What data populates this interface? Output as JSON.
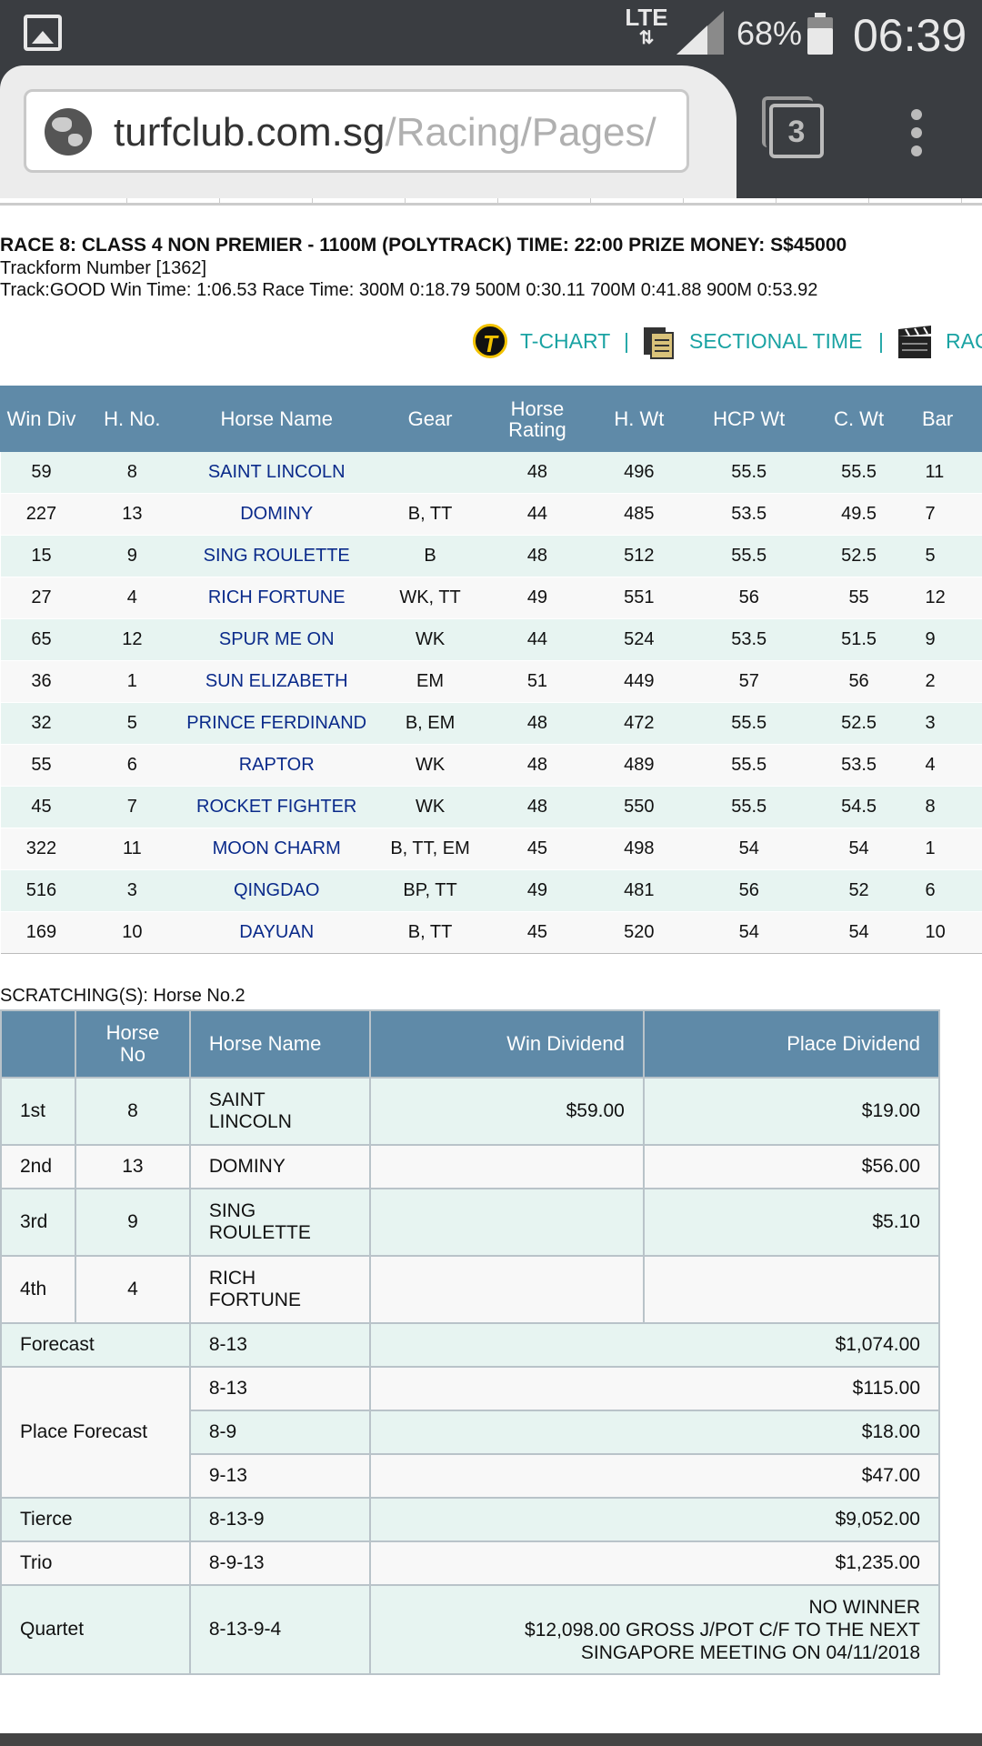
{
  "status": {
    "network": "LTE",
    "battery_pct": "68%",
    "time": "06:39"
  },
  "browser": {
    "url_domain": "turfclub.com.sg",
    "url_path": "/Racing/Pages/",
    "tab_count": "3"
  },
  "race": {
    "title": "RACE 8: CLASS 4 NON PREMIER - 1100M (POLYTRACK) TIME: 22:00 PRIZE MONEY: S$45000",
    "trackform": "Trackform Number [1362]",
    "track_info": "Track:GOOD Win Time: 1:06.53 Race Time: 300M 0:18.79  500M 0:30.11  700M 0:41.88  900M 0:53.92"
  },
  "links": {
    "tchart": "T-CHART",
    "sectional": "SECTIONAL TIME",
    "race_video": "RAC",
    "separator": "|"
  },
  "results": {
    "headers": [
      "Win Div",
      "H. No.",
      "Horse Name",
      "Gear",
      "Horse Rating",
      "H. Wt",
      "HCP Wt",
      "C. Wt",
      "Bar"
    ],
    "rows": [
      [
        "59",
        "8",
        "SAINT LINCOLN",
        "",
        "48",
        "496",
        "55.5",
        "55.5",
        "11"
      ],
      [
        "227",
        "13",
        "DOMINY",
        "B, TT",
        "44",
        "485",
        "53.5",
        "49.5",
        "7"
      ],
      [
        "15",
        "9",
        "SING ROULETTE",
        "B",
        "48",
        "512",
        "55.5",
        "52.5",
        "5"
      ],
      [
        "27",
        "4",
        "RICH FORTUNE",
        "WK, TT",
        "49",
        "551",
        "56",
        "55",
        "12"
      ],
      [
        "65",
        "12",
        "SPUR ME ON",
        "WK",
        "44",
        "524",
        "53.5",
        "51.5",
        "9"
      ],
      [
        "36",
        "1",
        "SUN ELIZABETH",
        "EM",
        "51",
        "449",
        "57",
        "56",
        "2"
      ],
      [
        "32",
        "5",
        "PRINCE FERDINAND",
        "B, EM",
        "48",
        "472",
        "55.5",
        "52.5",
        "3"
      ],
      [
        "55",
        "6",
        "RAPTOR",
        "WK",
        "48",
        "489",
        "55.5",
        "53.5",
        "4"
      ],
      [
        "45",
        "7",
        "ROCKET FIGHTER",
        "WK",
        "48",
        "550",
        "55.5",
        "54.5",
        "8"
      ],
      [
        "322",
        "11",
        "MOON CHARM",
        "B, TT, EM",
        "45",
        "498",
        "54",
        "54",
        "1"
      ],
      [
        "516",
        "3",
        "QINGDAO",
        "BP, TT",
        "49",
        "481",
        "56",
        "52",
        "6"
      ],
      [
        "169",
        "10",
        "DAYUAN",
        "B, TT",
        "45",
        "520",
        "54",
        "54",
        "10"
      ]
    ]
  },
  "scratchings": "SCRATCHING(S): Horse No.2",
  "dividends": {
    "headers": {
      "blank": "",
      "horse_no": "Horse No",
      "horse_name": "Horse Name",
      "win_div": "Win Dividend",
      "place_div": "Place Dividend"
    },
    "placings": [
      {
        "pos": "1st",
        "no": "8",
        "name": "SAINT LINCOLN",
        "win": "$59.00",
        "place": "$19.00"
      },
      {
        "pos": "2nd",
        "no": "13",
        "name": "DOMINY",
        "win": "",
        "place": "$56.00"
      },
      {
        "pos": "3rd",
        "no": "9",
        "name": "SING ROULETTE",
        "win": "",
        "place": "$5.10"
      },
      {
        "pos": "4th",
        "no": "4",
        "name": "RICH FORTUNE",
        "win": "",
        "place": ""
      }
    ],
    "forecast": {
      "label": "Forecast",
      "combo": "8-13",
      "amount": "$1,074.00"
    },
    "place_forecast": {
      "label": "Place Forecast",
      "items": [
        {
          "combo": "8-13",
          "amount": "$115.00"
        },
        {
          "combo": "8-9",
          "amount": "$18.00"
        },
        {
          "combo": "9-13",
          "amount": "$47.00"
        }
      ]
    },
    "tierce": {
      "label": "Tierce",
      "combo": "8-13-9",
      "amount": "$9,052.00"
    },
    "trio": {
      "label": "Trio",
      "combo": "8-9-13",
      "amount": "$1,235.00"
    },
    "quartet": {
      "label": "Quartet",
      "combo": "8-13-9-4",
      "line1": "NO WINNER",
      "line2": "$12,098.00 GROSS J/POT C/F TO THE NEXT",
      "line3": "SINGAPORE MEETING ON 04/11/2018"
    }
  }
}
